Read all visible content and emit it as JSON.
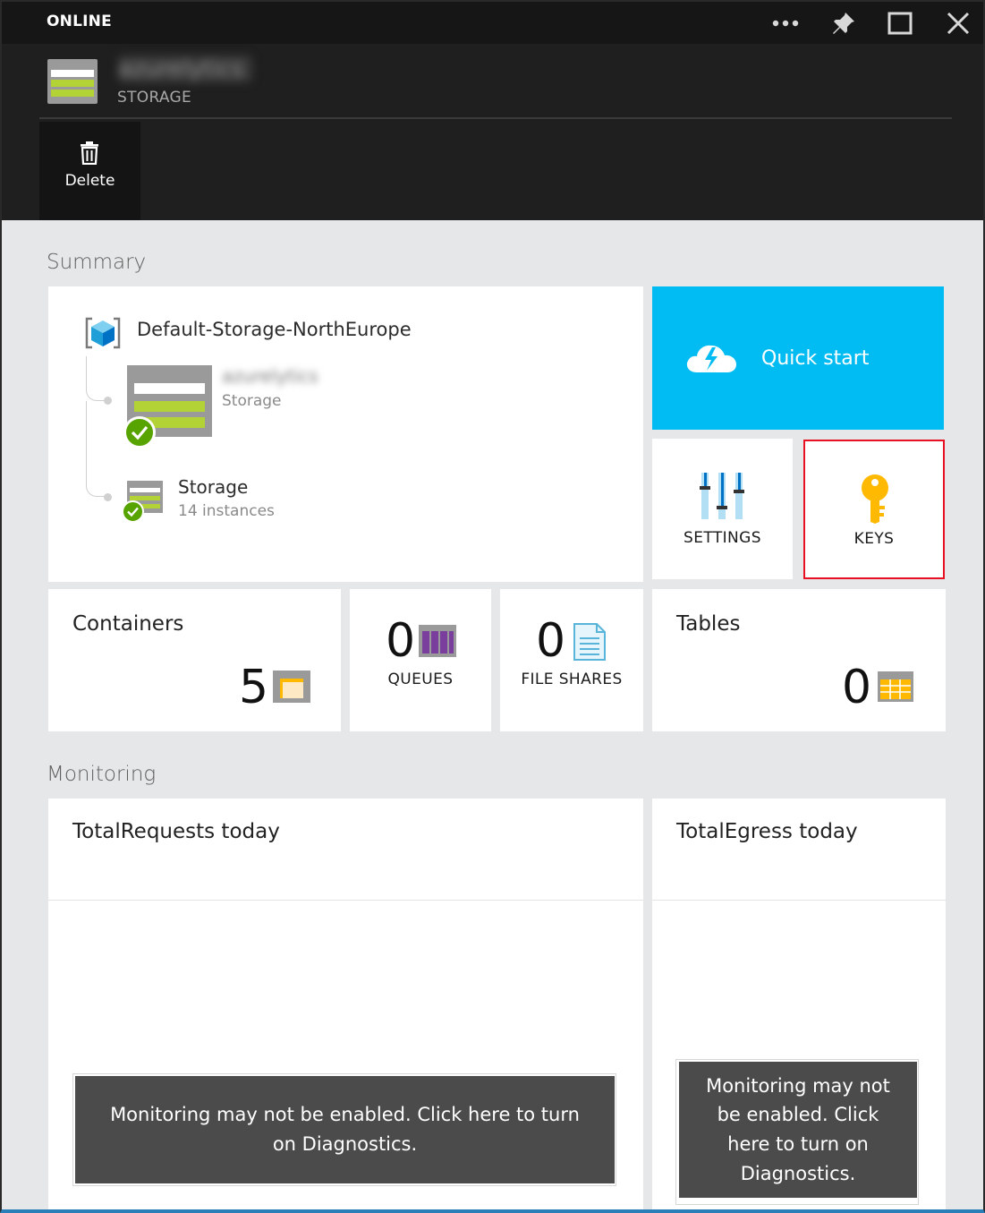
{
  "window": {
    "status": "ONLINE",
    "controls": [
      "more-icon",
      "pin-icon",
      "maximize-icon",
      "close-icon"
    ]
  },
  "resource": {
    "name": "azurelytics",
    "type": "STORAGE"
  },
  "commands": {
    "delete_label": "Delete"
  },
  "summary": {
    "title": "Summary",
    "resource_group": "Default-Storage-NorthEurope",
    "account": {
      "name": "azurelytics",
      "type": "Storage"
    },
    "group_item": {
      "name": "Storage",
      "count_label": "14 instances"
    },
    "quick_start_label": "Quick start",
    "settings_label": "SETTINGS",
    "keys_label": "KEYS"
  },
  "counts": {
    "containers": {
      "title": "Containers",
      "value": "5"
    },
    "queues": {
      "value": "0",
      "label": "QUEUES"
    },
    "file_shares": {
      "value": "0",
      "label": "FILE SHARES"
    },
    "tables": {
      "title": "Tables",
      "value": "0"
    }
  },
  "monitoring": {
    "title": "Monitoring",
    "requests_title": "TotalRequests today",
    "egress_title": "TotalEgress today",
    "warning_text": "Monitoring may not be enabled. Click here to turn on Diagnostics."
  },
  "colors": {
    "accent": "#00bcf2",
    "highlight": "#e81123",
    "success": "#57a300",
    "storage_green": "#b2d235"
  }
}
